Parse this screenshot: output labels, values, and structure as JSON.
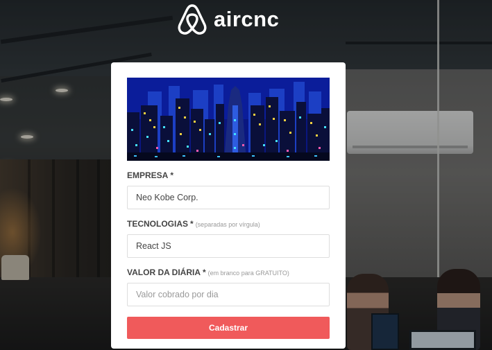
{
  "app": {
    "logo_text": "aircnc",
    "logo_icon": "airbnb-belo-icon",
    "brand_color": "#f05a5b"
  },
  "form": {
    "hero_image": "pixel-art-city-skyline",
    "empresa": {
      "label": "EMPRESA",
      "required_mark": "*",
      "hint": "",
      "value": "Neo Kobe Corp.",
      "placeholder": ""
    },
    "tecnologias": {
      "label": "TECNOLOGIAS",
      "required_mark": "*",
      "hint": "(separadas por vírgula)",
      "value": "React JS",
      "placeholder": ""
    },
    "valor": {
      "label": "VALOR DA DIÁRIA",
      "required_mark": "*",
      "hint": "(em branco para GRATUITO)",
      "value": "",
      "placeholder": "Valor cobrado por dia"
    },
    "submit_label": "Cadastrar"
  }
}
